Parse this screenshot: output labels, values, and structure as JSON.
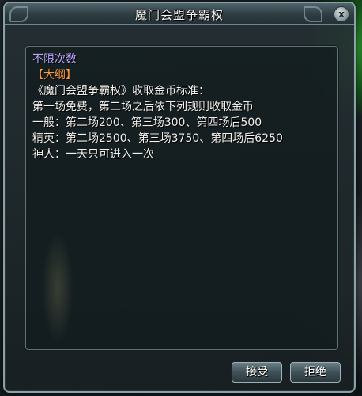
{
  "window": {
    "title": "魔门会盟争霸权",
    "close_glyph": "x"
  },
  "content": {
    "lines": [
      "不限次数",
      "【大纲】",
      "《魔门会盟争霸权》收取金币标准：",
      "第一场免费，第二场之后依下列规则收取金币",
      "一般：第二场200、第三场300、第四场后500",
      "精英：第二场2500、第三场3750、第四场后6250",
      "神人：一天只可进入一次"
    ]
  },
  "buttons": {
    "accept_label": "接受",
    "reject_label": "拒绝"
  },
  "colors": {
    "highlight_purple": "#b8a6ff",
    "highlight_orange": "#ff9b3c",
    "text_white": "#f2f2ee"
  }
}
